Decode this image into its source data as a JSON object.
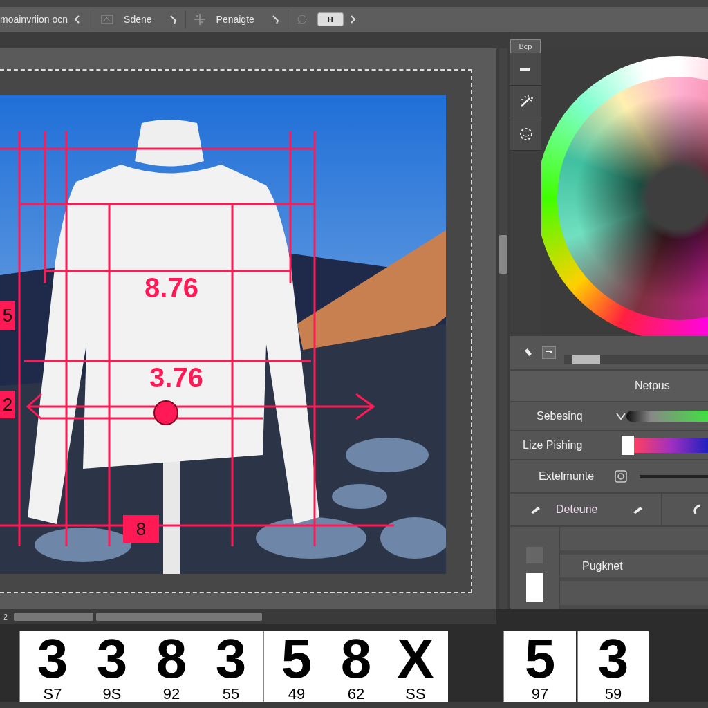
{
  "options_bar": {
    "preset": "moainvriion ocn",
    "tool_1": "Sdene",
    "tool_2": "Penaigte",
    "key": "H"
  },
  "tool_column": {
    "button": "Bcp"
  },
  "canvas": {
    "annotations": [
      {
        "kind": "value",
        "text": "8.76"
      },
      {
        "kind": "value",
        "text": "3.76"
      },
      {
        "kind": "tag",
        "text": "5"
      },
      {
        "kind": "tag",
        "text": "2"
      },
      {
        "kind": "tag",
        "text": "8"
      }
    ]
  },
  "properties": {
    "title": "Netpus",
    "rows": [
      {
        "kind": "gradient",
        "label": "Sebesinq"
      },
      {
        "kind": "swatch",
        "label": "Lize Pishing"
      },
      {
        "kind": "line",
        "label": "Extelmunte"
      },
      {
        "kind": "action",
        "label": "Deteune"
      }
    ]
  },
  "layers": {
    "label": "Pugknet"
  },
  "scrollbar": {
    "page": "2"
  },
  "strip": {
    "blocks": [
      {
        "tiles": [
          {
            "digit": "3",
            "caption": "S7"
          },
          {
            "digit": "3",
            "caption": "9S"
          },
          {
            "digit": "8",
            "caption": "92"
          },
          {
            "digit": "3",
            "caption": "55"
          }
        ]
      },
      {
        "tiles": [
          {
            "digit": "5",
            "caption": "49"
          },
          {
            "digit": "8",
            "caption": "62"
          },
          {
            "digit": "X",
            "caption": "SS"
          }
        ]
      },
      {
        "tiles": [
          {
            "digit": "5",
            "caption": "97"
          }
        ]
      },
      {
        "tiles": [
          {
            "digit": "3",
            "caption": "59"
          }
        ]
      }
    ]
  }
}
